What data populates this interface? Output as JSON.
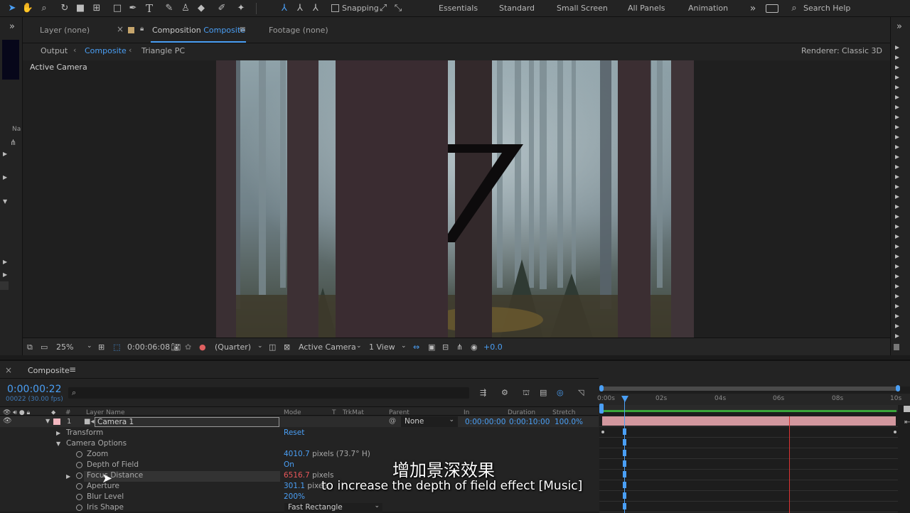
{
  "toolbar": {
    "snapping_label": "Snapping",
    "workspaces": [
      "Essentials",
      "Standard",
      "Small Screen",
      "All Panels",
      "Animation"
    ],
    "search_placeholder": "Search Help"
  },
  "composition_panel": {
    "tabs": {
      "layer": "Layer (none)",
      "composition_prefix": "Composition",
      "composition_name": "Composite",
      "footage": "Footage (none)"
    },
    "breadcrumb": [
      "Output",
      "Composite",
      "Triangle PC"
    ],
    "renderer_label": "Renderer:",
    "renderer_value": "Classic 3D",
    "view_label": "Active Camera",
    "viewer_bar": {
      "zoom": "25%",
      "timecode": "0:00:06:08",
      "resolution": "(Quarter)",
      "camera": "Active Camera",
      "views": "1 View",
      "exposure": "+0.0"
    }
  },
  "left_strip": {
    "label": "Na"
  },
  "timeline": {
    "title": "Composite",
    "timecode": "0:00:00:22",
    "frame_info": "00022 (30.00 fps)",
    "columns": {
      "layer_name": "Layer Name",
      "mode": "Mode",
      "t": "T",
      "trkmat": "TrkMat",
      "parent": "Parent",
      "in": "In",
      "duration": "Duration",
      "stretch": "Stretch"
    },
    "layer": {
      "number": "1",
      "name": "Camera 1",
      "parent": "None",
      "in": "0:00:00:00",
      "duration": "0:00:10:00",
      "stretch": "100.0%"
    },
    "properties": {
      "transform": "Transform",
      "reset": "Reset",
      "camera_options": "Camera Options",
      "zoom_label": "Zoom",
      "zoom_value": "4010.7",
      "zoom_unit": "pixels (73.7° H)",
      "dof_label": "Depth of Field",
      "dof_value": "On",
      "focus_label": "Focus Distance",
      "focus_value": "6516.7",
      "focus_unit": "pixels",
      "aperture_label": "Aperture",
      "aperture_value": "301.1",
      "aperture_unit": "pixels",
      "blur_label": "Blur Level",
      "blur_value": "200%",
      "iris_label": "Iris Shape",
      "iris_value": "Fast Rectangle"
    },
    "ruler": [
      "0:00s",
      "02s",
      "04s",
      "06s",
      "08s",
      "10s"
    ]
  },
  "subtitles": {
    "chinese": "增加景深效果",
    "english": "to increase the depth of field effect [Music]"
  },
  "colors": {
    "accent": "#4a9ff5",
    "keyframe_value": "#e8575a",
    "layer_bar": "#d2979e",
    "work_area": "#3aa53a"
  }
}
